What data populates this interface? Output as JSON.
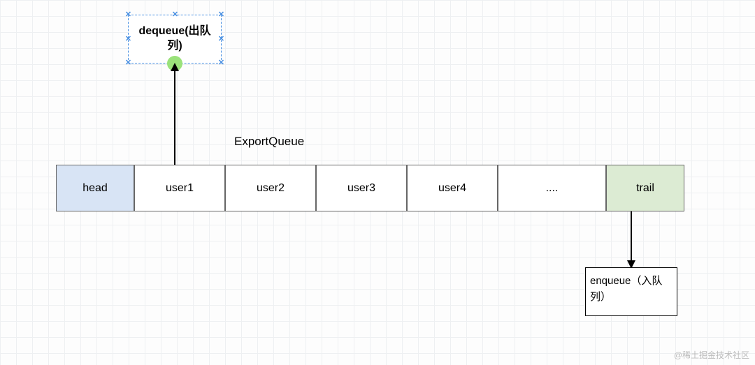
{
  "title": "ExportQueue",
  "dequeue_label": "dequeue(出队列)",
  "enqueue_label": "enqueue（入队列）",
  "cells": {
    "head": "head",
    "u1": "user1",
    "u2": "user2",
    "u3": "user3",
    "u4": "user4",
    "dots": "....",
    "trail": "trail"
  },
  "watermark": "@稀土掘金技术社区"
}
